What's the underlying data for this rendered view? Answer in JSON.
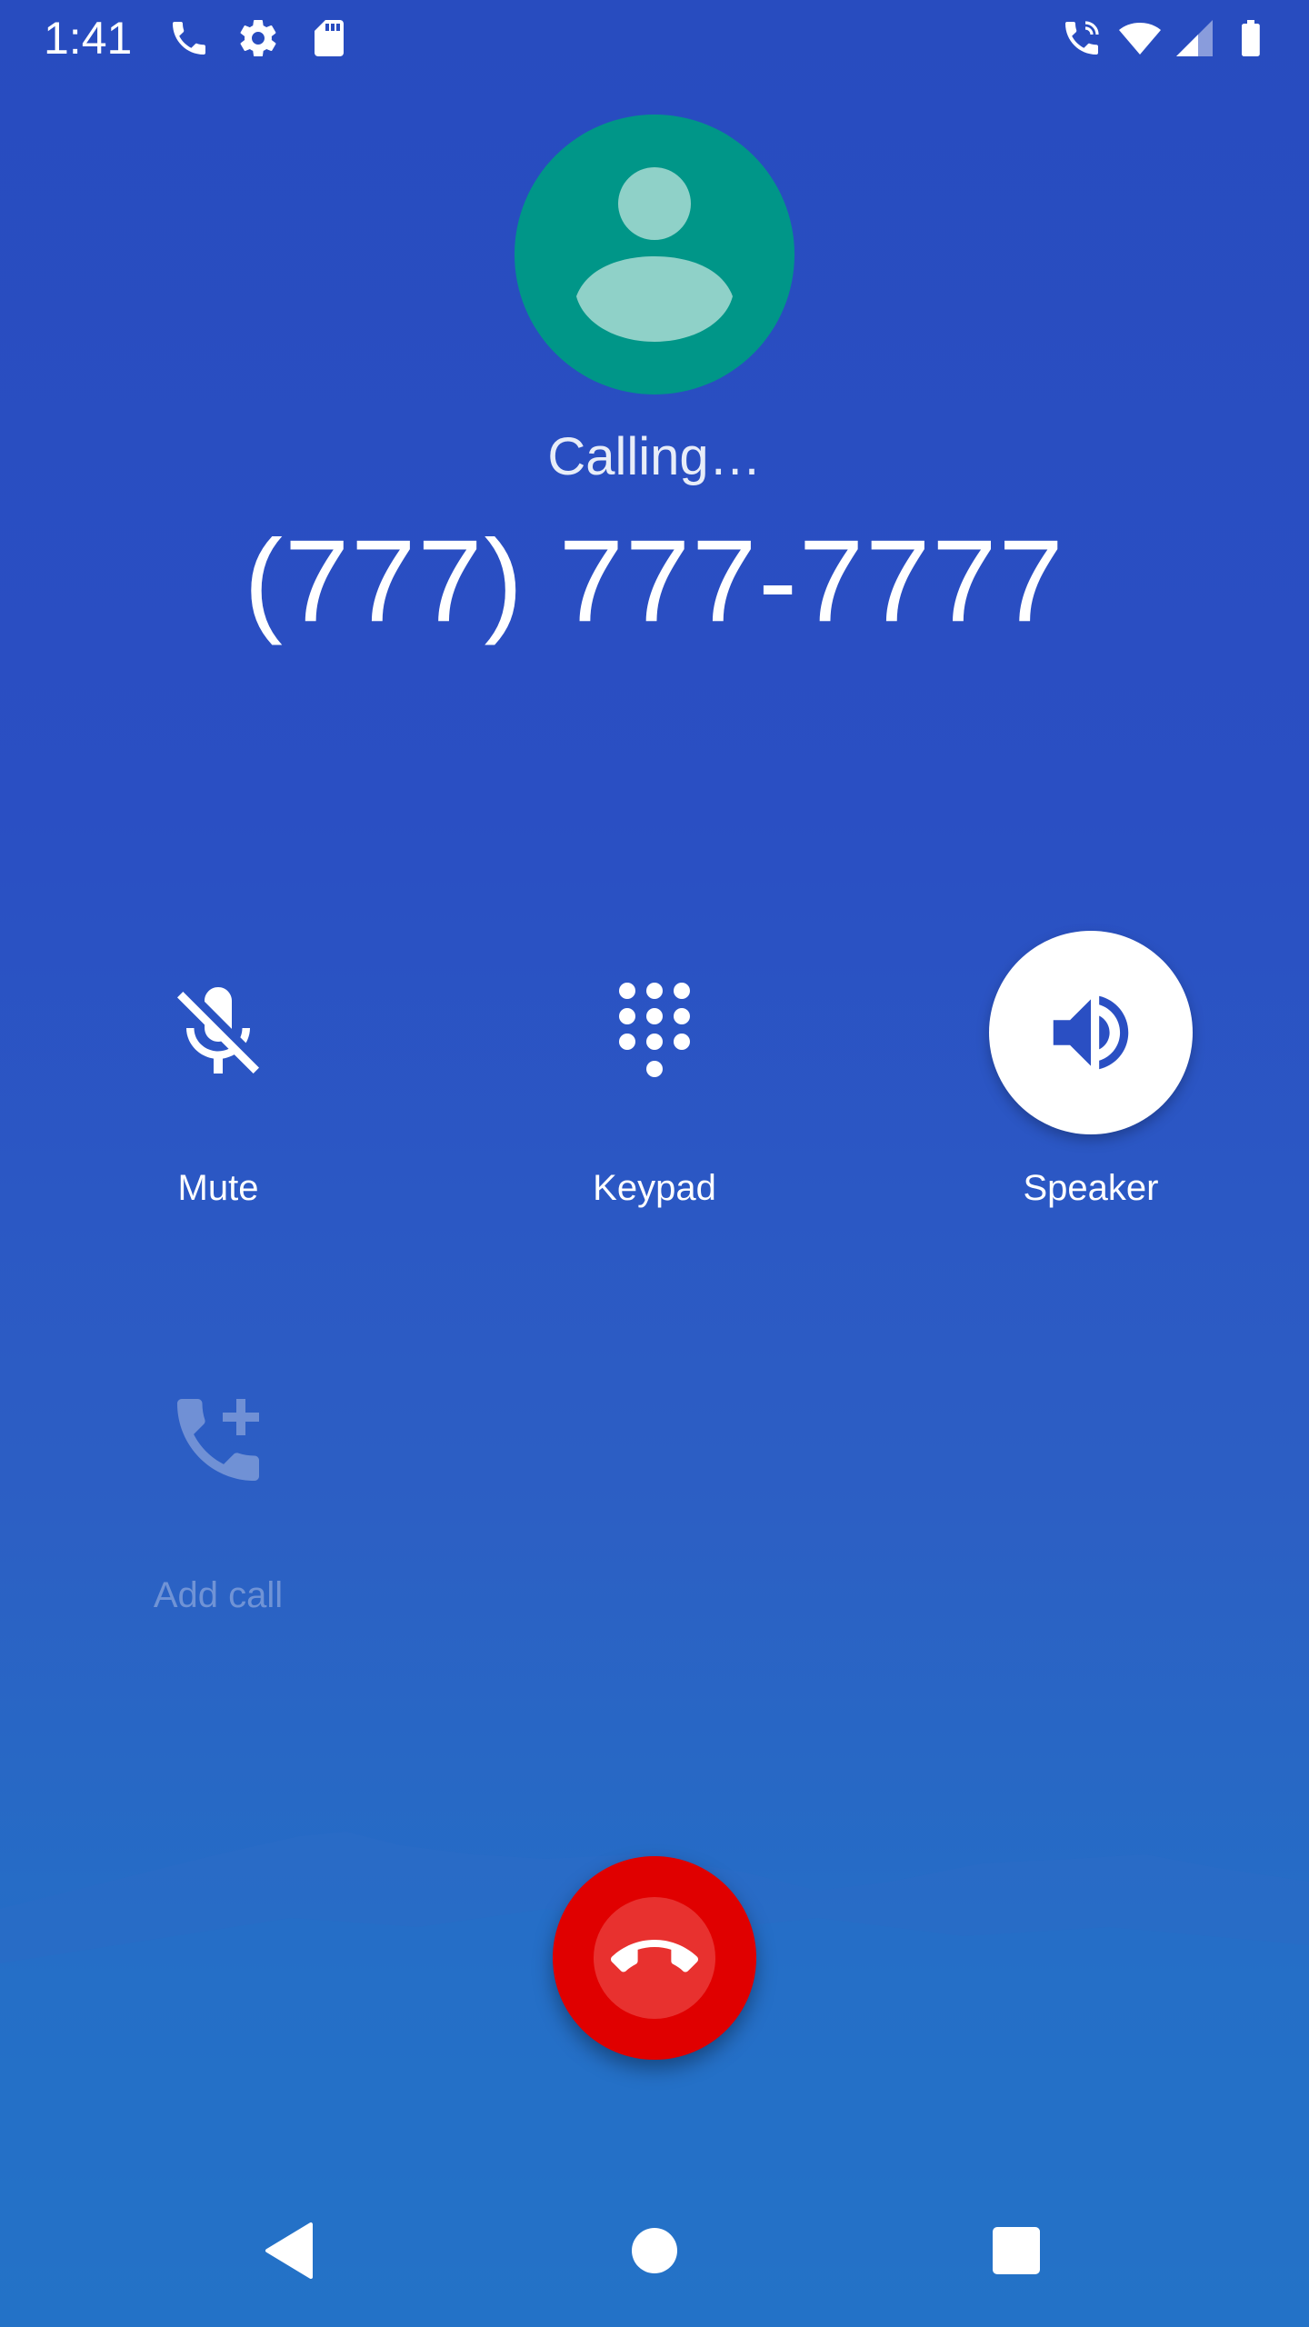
{
  "status_bar": {
    "time": "1:41",
    "left_icons": [
      "phone-icon",
      "gear-icon",
      "sd-card-icon"
    ],
    "right_icons": [
      "call-in-progress-icon",
      "wifi-icon",
      "cellular-signal-icon",
      "battery-icon"
    ]
  },
  "call": {
    "avatar_icon": "person-icon",
    "status": "Calling…",
    "number": "(777) 777-7777"
  },
  "actions": {
    "mute": {
      "label": "Mute",
      "icon": "mic-off-icon",
      "enabled": true,
      "active": false
    },
    "keypad": {
      "label": "Keypad",
      "icon": "dialpad-icon",
      "enabled": true,
      "active": false
    },
    "speaker": {
      "label": "Speaker",
      "icon": "speaker-icon",
      "enabled": true,
      "active": true
    },
    "add_call": {
      "label": "Add call",
      "icon": "add-call-icon",
      "enabled": false,
      "active": false
    }
  },
  "end_call": {
    "icon": "hang-up-icon",
    "color": "#e00000"
  },
  "nav_bar": {
    "icons": [
      "back-icon",
      "home-icon",
      "recents-icon"
    ]
  },
  "colors": {
    "background": "#284cbf",
    "avatar": "#009688",
    "end_call": "#e00000"
  }
}
